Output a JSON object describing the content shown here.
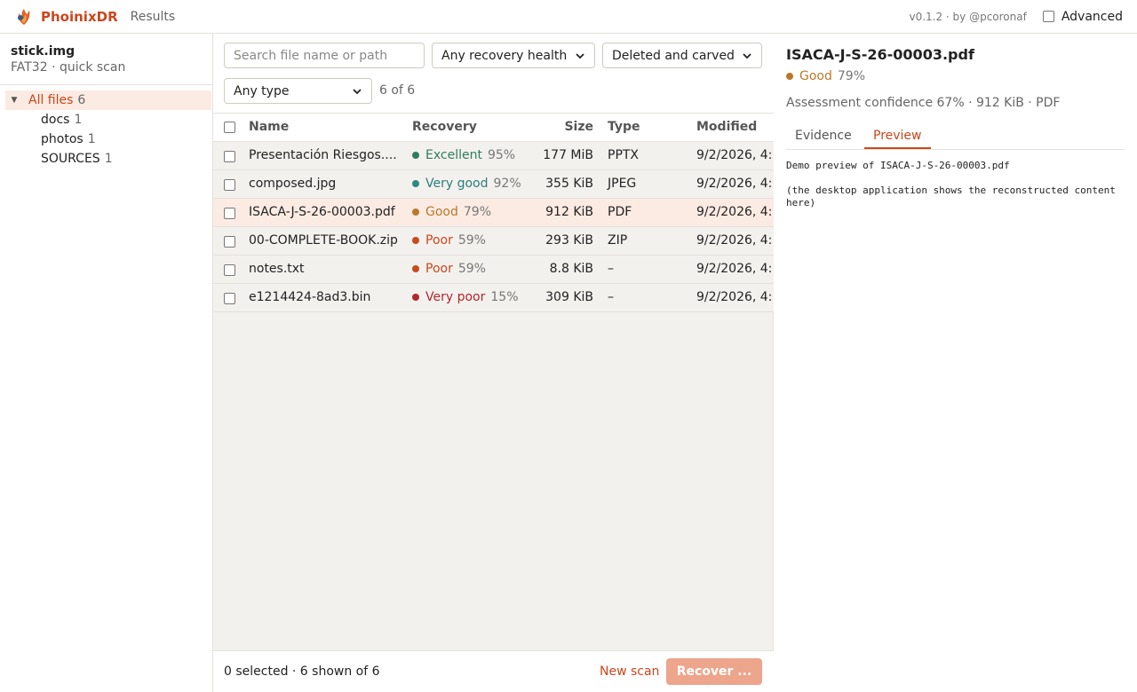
{
  "header": {
    "brand": "PhoinixDR",
    "section": "Results",
    "version": "v0.1.2 · by @pcoronaf",
    "advanced_label": "Advanced"
  },
  "sidebar": {
    "image_name": "stick.img",
    "image_meta": "FAT32 · quick scan",
    "root": {
      "label": "All files",
      "count": "6"
    },
    "children": [
      {
        "label": "docs",
        "count": "1"
      },
      {
        "label": "photos",
        "count": "1"
      },
      {
        "label": "SOURCES",
        "count": "1"
      }
    ]
  },
  "filters": {
    "search_placeholder": "Search file name or path",
    "health": "Any recovery health",
    "mode": "Deleted and carved",
    "type": "Any type",
    "count": "6 of 6"
  },
  "table": {
    "headers": {
      "name": "Name",
      "recovery": "Recovery",
      "size": "Size",
      "type": "Type",
      "modified": "Modified"
    },
    "rows": [
      {
        "name": "Presentación Riesgos....",
        "health": "Excellent",
        "pct": "95%",
        "size": "177 MiB",
        "type": "PPTX",
        "modified": "9/2/2026, 4:",
        "dot": "#2e7d5b",
        "color": "#2e7d5b"
      },
      {
        "name": "composed.jpg",
        "health": "Very good",
        "pct": "92%",
        "size": "355 KiB",
        "type": "JPEG",
        "modified": "9/2/2026, 4:",
        "dot": "#2a8a86",
        "color": "#2a7f7c"
      },
      {
        "name": "ISACA-J-S-26-00003.pdf",
        "health": "Good",
        "pct": "79%",
        "size": "912 KiB",
        "type": "PDF",
        "modified": "9/2/2026, 4:",
        "dot": "#b8792a",
        "color": "#b8792a"
      },
      {
        "name": "00-COMPLETE-BOOK.zip",
        "health": "Poor",
        "pct": "59%",
        "size": "293 KiB",
        "type": "ZIP",
        "modified": "9/2/2026, 4:",
        "dot": "#c94a1c",
        "color": "#c9471c"
      },
      {
        "name": "notes.txt",
        "health": "Poor",
        "pct": "59%",
        "size": "8.8 KiB",
        "type": "–",
        "modified": "9/2/2026, 4:",
        "dot": "#c94a1c",
        "color": "#c9471c"
      },
      {
        "name": "e1214424-8ad3.bin",
        "health": "Very poor",
        "pct": "15%",
        "size": "309 KiB",
        "type": "–",
        "modified": "9/2/2026, 4:",
        "dot": "#b3262e",
        "color": "#b3262e"
      }
    ]
  },
  "footer": {
    "selection": "0 selected · 6 shown of 6",
    "new_scan": "New scan",
    "recover": "Recover ..."
  },
  "detail": {
    "title": "ISACA-J-S-26-00003.pdf",
    "health": "Good",
    "pct": "79%",
    "meta": "Assessment confidence 67% · 912 KiB · PDF",
    "tabs": [
      "Evidence",
      "Preview"
    ],
    "preview_line1": "Demo preview of ISACA-J-S-26-00003.pdf",
    "preview_line2": "(the desktop application shows the reconstructed content here)"
  },
  "colors": {
    "accent": "#c9471c",
    "good": "#b8792a"
  }
}
